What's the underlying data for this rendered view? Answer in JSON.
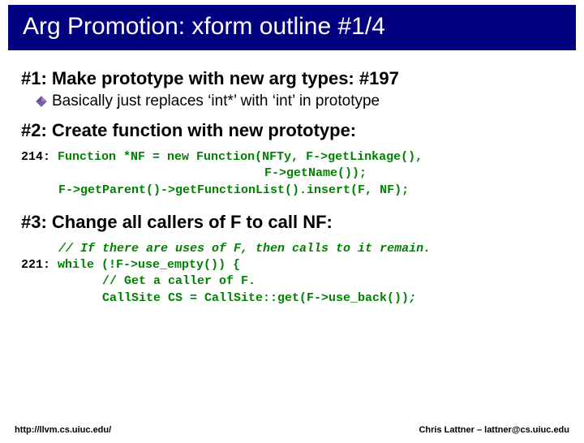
{
  "title": "Arg Promotion: xform outline #1/4",
  "sections": {
    "s1_heading": "#1: Make prototype with new arg types: #197",
    "s1_bullet": "Basically just replaces ‘int*’ with ‘int’ in prototype",
    "s2_heading": "#2: Create function with new prototype:",
    "s3_heading": "#3: Change all callers of F to call NF:"
  },
  "code1": {
    "lineno": "214:",
    "l1": "Function *NF = new Function(NFTy, F->getLinkage(),",
    "l2": "F->getName());",
    "l3": "F->getParent()->getFunctionList().insert(F, NF);"
  },
  "code2": {
    "c1": "// If there are uses of F, then calls to it remain.",
    "lineno": "221:",
    "l1": "while (!F->use_empty()) {",
    "c2": "// Get a caller of F.",
    "l2a": "CallSite CS = CallSite::get(F->use_back())",
    "l2b": ";"
  },
  "footer": {
    "left": "http://llvm.cs.uiuc.edu/",
    "right": "Chris Lattner – lattner@cs.uiuc.edu"
  }
}
